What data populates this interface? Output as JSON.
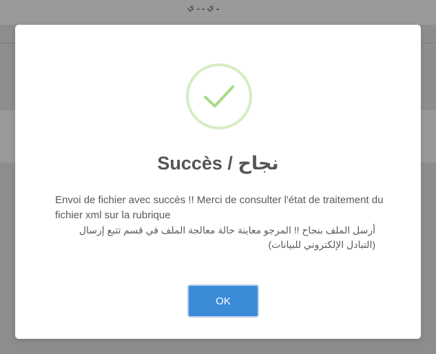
{
  "background": {
    "title_fragment": "ـ ي ـ ـ ي"
  },
  "dialog": {
    "icon": "checkmark-icon",
    "accent_color": "#a5dc86",
    "title": "Succès / نجاح",
    "message_fr": "Envoi de fichier avec succès !! Merci de consulter l'état de traitement du fichier xml sur la rubrique",
    "message_ar": "أرسل الملف بنجاح !! المرجو معاينة حالة معالجة الملف في قسم تتبع إرسال (التبادل الإلكتروني للبيانات)",
    "ok_label": "OK",
    "button_color": "#3c8bd9"
  }
}
